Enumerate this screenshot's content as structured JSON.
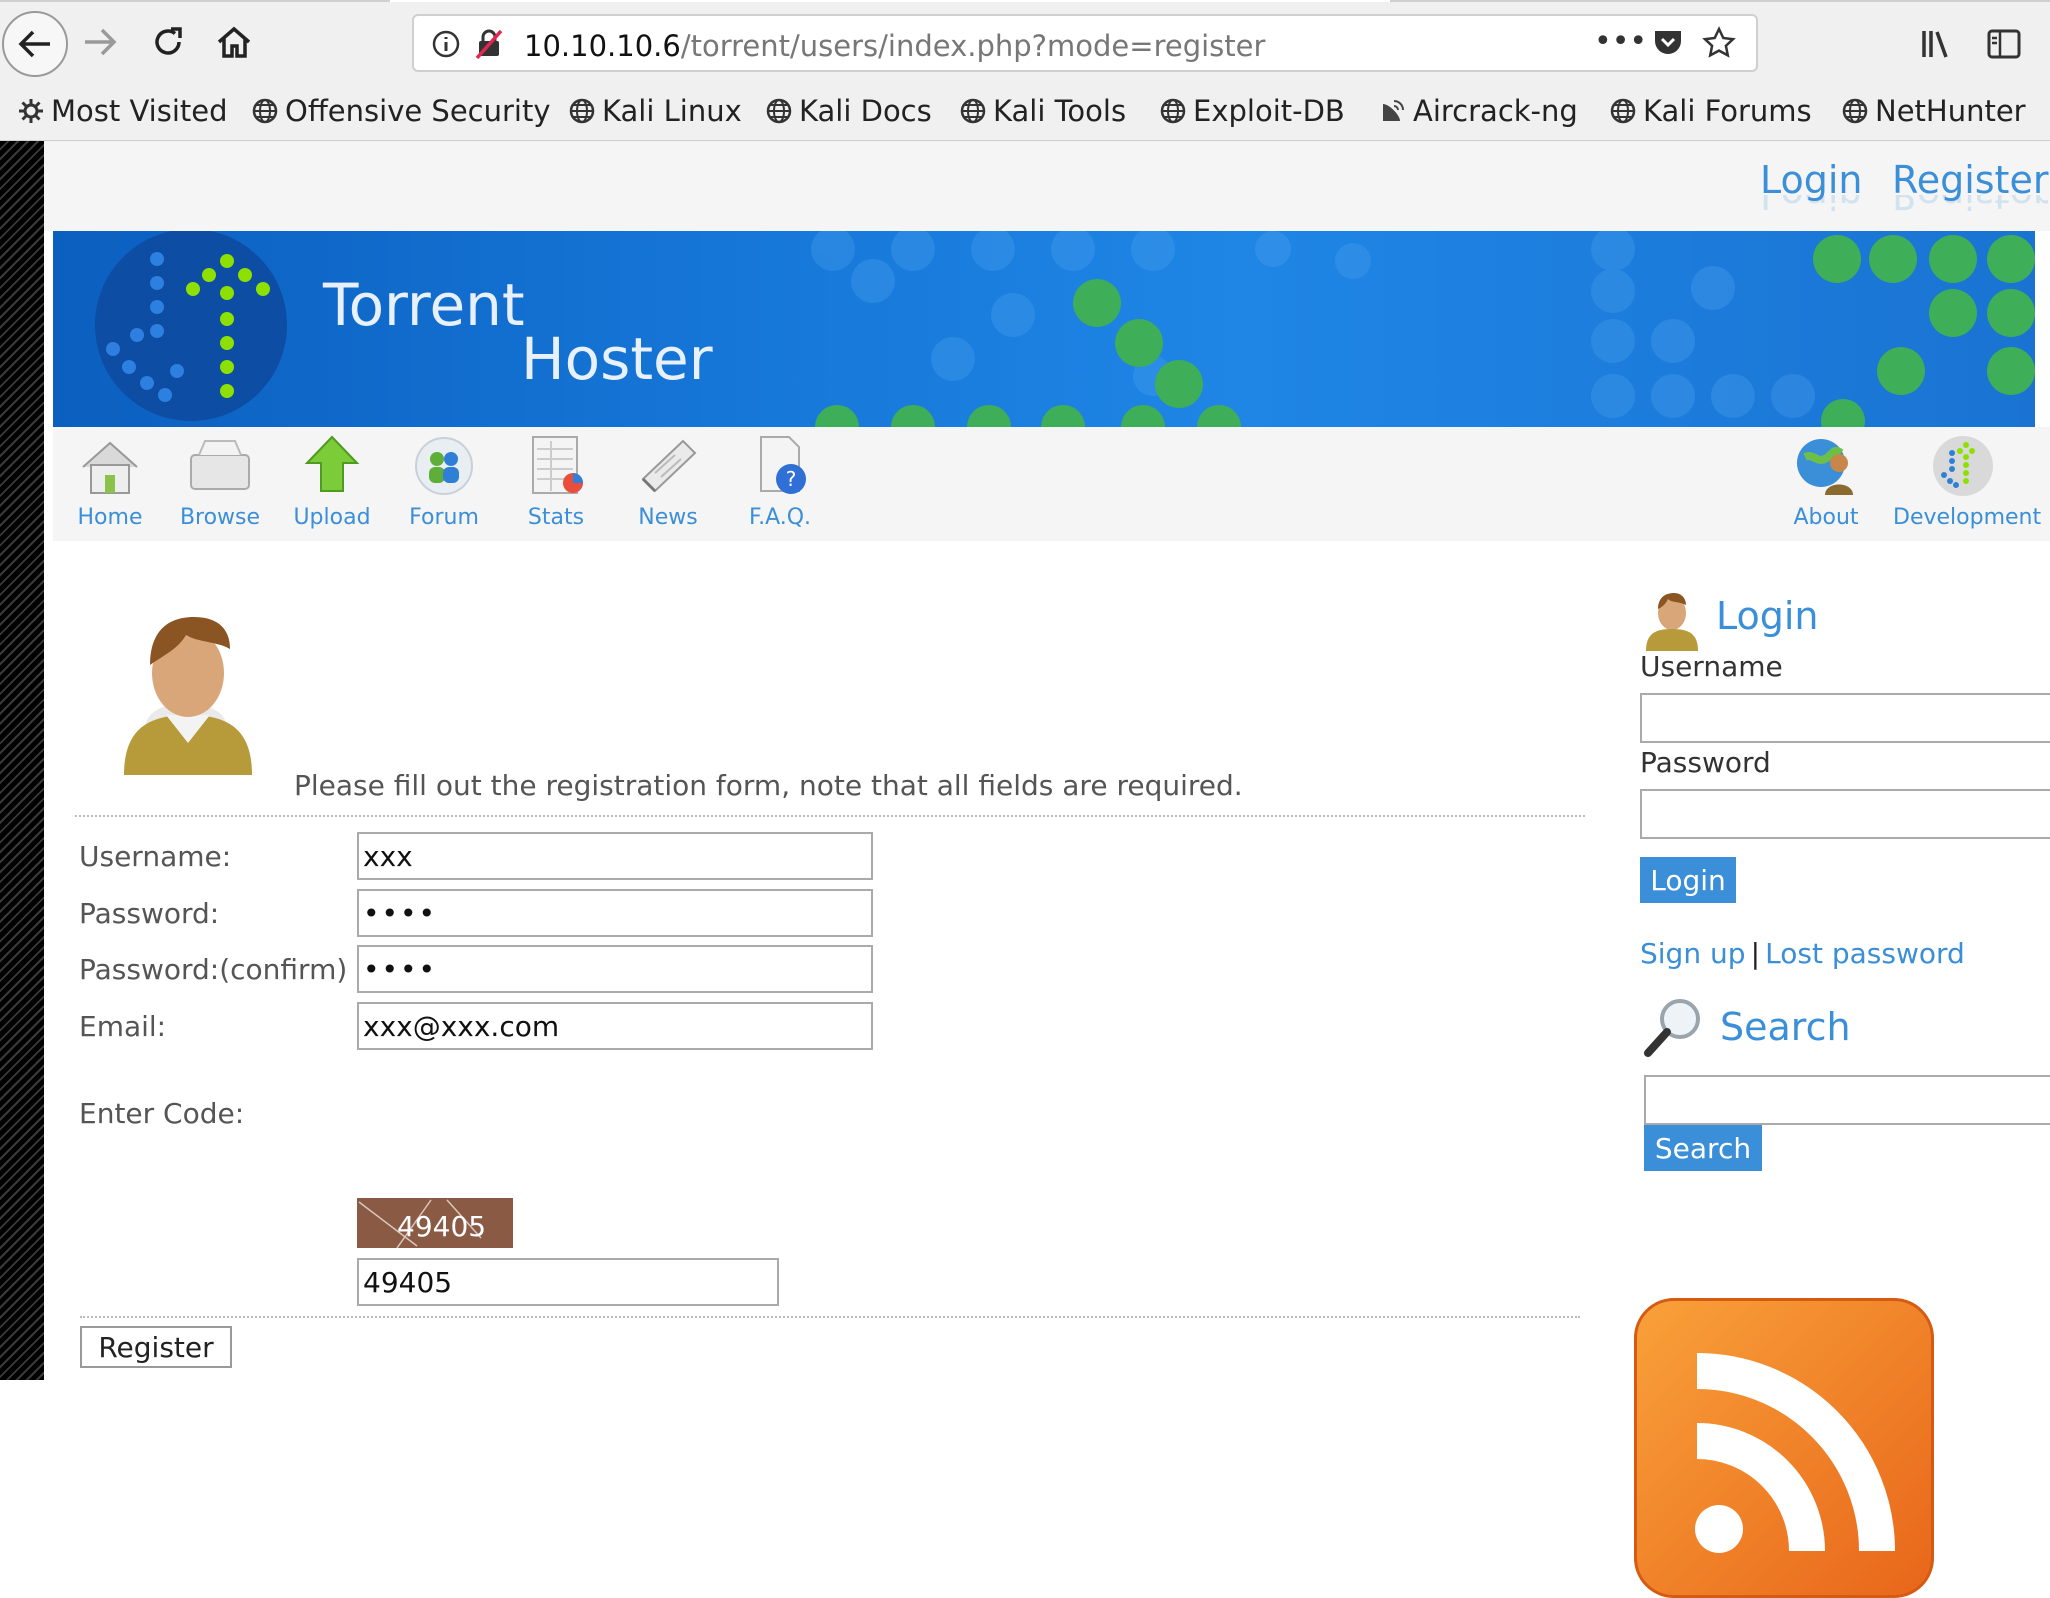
{
  "browser": {
    "url_host": "10.10.10.6",
    "url_path": "/torrent/users/index.php?mode=register",
    "bookmarks": [
      "Most Visited",
      "Offensive Security",
      "Kali Linux",
      "Kali Docs",
      "Kali Tools",
      "Exploit-DB",
      "Aircrack-ng",
      "Kali Forums",
      "NetHunter"
    ]
  },
  "site": {
    "top_links": {
      "login": "Login",
      "register": "Register"
    },
    "brand_line1": "Torrent",
    "brand_line2": "Hoster",
    "menu": [
      "Home",
      "Browse",
      "Upload",
      "Forum",
      "Stats",
      "News",
      "F.A.Q."
    ],
    "menu_right": [
      "About",
      "Development"
    ]
  },
  "register_form": {
    "intro": "Please fill out the registration form, note that all fields are required.",
    "username_label": "Username:",
    "username_value": "xxx",
    "password_label": "Password:",
    "password_value": "xxxx",
    "confirm_label": "Password:(confirm)",
    "confirm_value": "xxxx",
    "email_label": "Email:",
    "email_value": "xxx@xxx.com",
    "code_label": "Enter Code:",
    "captcha_text": "49405",
    "code_value": "49405",
    "submit_label": "Register"
  },
  "sidebar": {
    "login_heading": "Login",
    "username_label": "Username",
    "password_label": "Password",
    "login_button": "Login",
    "signup_link": "Sign up",
    "separator": "|",
    "lost_password_link": "Lost password",
    "search_heading": "Search",
    "search_button": "Search"
  },
  "colors": {
    "link_blue": "#3a8fd8",
    "banner_blue": "#1677d8",
    "rss_orange": "#f28c28"
  }
}
